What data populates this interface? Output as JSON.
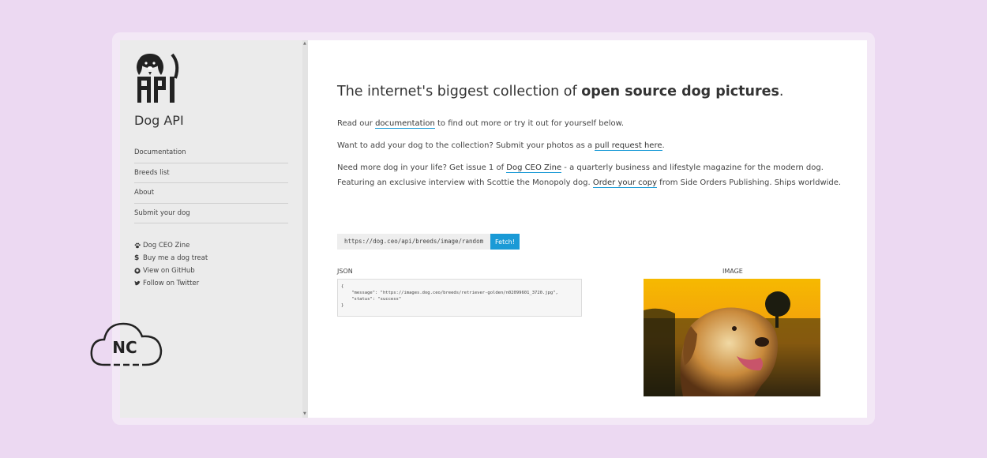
{
  "site": {
    "title": "Dog API"
  },
  "sidebar": {
    "nav": [
      {
        "label": "Documentation"
      },
      {
        "label": "Breeds list"
      },
      {
        "label": "About"
      },
      {
        "label": "Submit your dog"
      }
    ],
    "links": [
      {
        "label": "Dog CEO Zine",
        "icon": "paw-icon"
      },
      {
        "label": "Buy me a dog treat",
        "icon": "dollar-icon"
      },
      {
        "label": "View on GitHub",
        "icon": "github-icon"
      },
      {
        "label": "Follow on Twitter",
        "icon": "twitter-icon"
      }
    ]
  },
  "main": {
    "headline": {
      "prefix": "The internet's biggest collection of ",
      "bold": "open source dog pictures",
      "suffix": "."
    },
    "p1": {
      "before": "Read our ",
      "link": "documentation",
      "after": " to find out more or try it out for yourself below."
    },
    "p2": {
      "before": "Want to add your dog to the collection? Submit your photos as a ",
      "link": "pull request here",
      "after": "."
    },
    "p3": {
      "before": "Need more dog in your life? Get issue 1 of ",
      "link1": "Dog CEO Zine",
      "middle": " - a quarterly business and lifestyle magazine for the modern dog. Featuring an exclusive interview with Scottie the Monopoly dog. ",
      "link2": "Order your copy",
      "after": " from Side Orders Publishing. Ships worldwide."
    },
    "fetch": {
      "url": "https://dog.ceo/api/breeds/image/random",
      "button": "Fetch!"
    },
    "json_label": "JSON",
    "json_lines": [
      "{",
      "    \"message\": \"https://images.dog.ceo/breeds/retriever-golden/n02099601_3720.jpg\",",
      "    \"status\": \"success\"",
      "}"
    ],
    "image_label": "IMAGE"
  },
  "badge": {
    "text": "NC"
  },
  "colors": {
    "accent": "#1a9ad6",
    "background": "#ecd9f2",
    "sidebar": "#ebebeb"
  }
}
